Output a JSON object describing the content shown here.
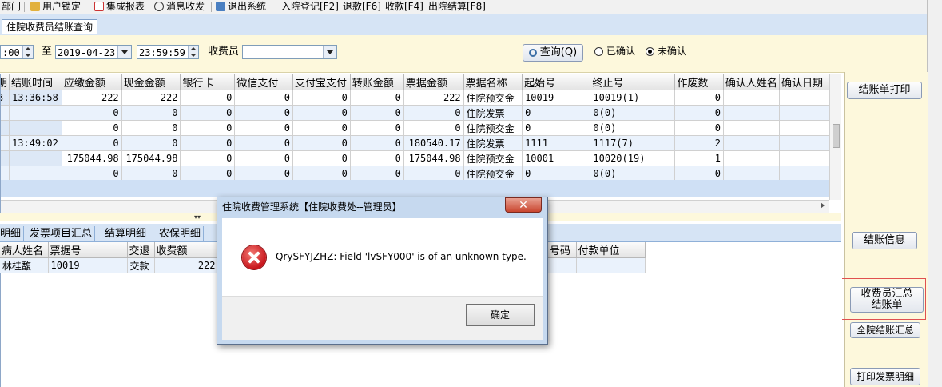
{
  "toolbar": {
    "items": [
      {
        "label": "部门"
      },
      {
        "label": "用户锁定"
      },
      {
        "label": "集成报表"
      },
      {
        "label": "消息收发"
      },
      {
        "label": "退出系统"
      },
      {
        "label": "入院登记[F2]"
      },
      {
        "label": "退款[F6]"
      },
      {
        "label": "收款[F4]"
      },
      {
        "label": "出院结算[F8]"
      }
    ]
  },
  "tabs": {
    "main": "住院收费员结账查询"
  },
  "filter": {
    "time_start": ":00",
    "to_label": "至",
    "date_end": "2019-04-23",
    "time_end": "23:59:59",
    "cashier_label": "收费员",
    "cashier_value": "",
    "query_button": "查询(Q)",
    "radio_confirmed": "已确认",
    "radio_unconfirmed": "未确认"
  },
  "grid1": {
    "columns": [
      "期",
      "结账时间",
      "应缴金额",
      "现金金额",
      "银行卡",
      "微信支付",
      "支付宝支付",
      "转账金额",
      "票据金额",
      "票据名称",
      "起始号",
      "终止号",
      "作废数",
      "确认人姓名",
      "确认日期"
    ],
    "rows": [
      [
        "3",
        "13:36:58",
        "222",
        "222",
        "0",
        "0",
        "0",
        "0",
        "222",
        "住院预交金",
        "10019",
        "10019(1)",
        "0",
        "",
        ""
      ],
      [
        "",
        "",
        "0",
        "0",
        "0",
        "0",
        "0",
        "0",
        "0",
        "住院发票",
        "0",
        "0(0)",
        "0",
        "",
        ""
      ],
      [
        "",
        "",
        "0",
        "0",
        "0",
        "0",
        "0",
        "0",
        "0",
        "住院预交金",
        "0",
        "0(0)",
        "0",
        "",
        ""
      ],
      [
        "",
        "13:49:02",
        "0",
        "0",
        "0",
        "0",
        "0",
        "0",
        "180540.17",
        "住院发票",
        "1111",
        "1117(7)",
        "2",
        "",
        ""
      ],
      [
        "",
        "",
        "175044.98",
        "175044.98",
        "0",
        "0",
        "0",
        "0",
        "175044.98",
        "住院预交金",
        "10001",
        "10020(19)",
        "1",
        "",
        ""
      ],
      [
        "",
        "",
        "0",
        "0",
        "0",
        "0",
        "0",
        "0",
        "0",
        "住院预交金",
        "0",
        "0(0)",
        "0",
        "",
        ""
      ]
    ]
  },
  "lower_tabs": [
    "明细",
    "发票项目汇总",
    "结算明细",
    "农保明细"
  ],
  "grid2": {
    "columns": [
      "病人姓名",
      "票据号",
      "交退",
      "收费额"
    ],
    "columns_right": [
      "号码",
      "付款单位"
    ],
    "rows": [
      [
        "林桂馥",
        "10019",
        "交款",
        "222"
      ]
    ]
  },
  "side": {
    "print_statement": "结账单打印",
    "statement_info": "结账信息",
    "cashier_summary_line1": "收费员汇总",
    "cashier_summary_line2": "结账单",
    "hospital_summary": "全院结账汇总",
    "print_invoice_detail": "打印发票明细"
  },
  "dialog": {
    "title": "住院收费管理系统【住院收费处--管理员】",
    "close": "✕",
    "message": "QrySFYJZHZ: Field 'lvSFY000' is of an unknown type.",
    "ok": "确定"
  },
  "colors": {
    "accent": "#d6e4f5",
    "panel": "#fdf8dc",
    "error": "#c8161c",
    "highlight": "#e05050"
  }
}
